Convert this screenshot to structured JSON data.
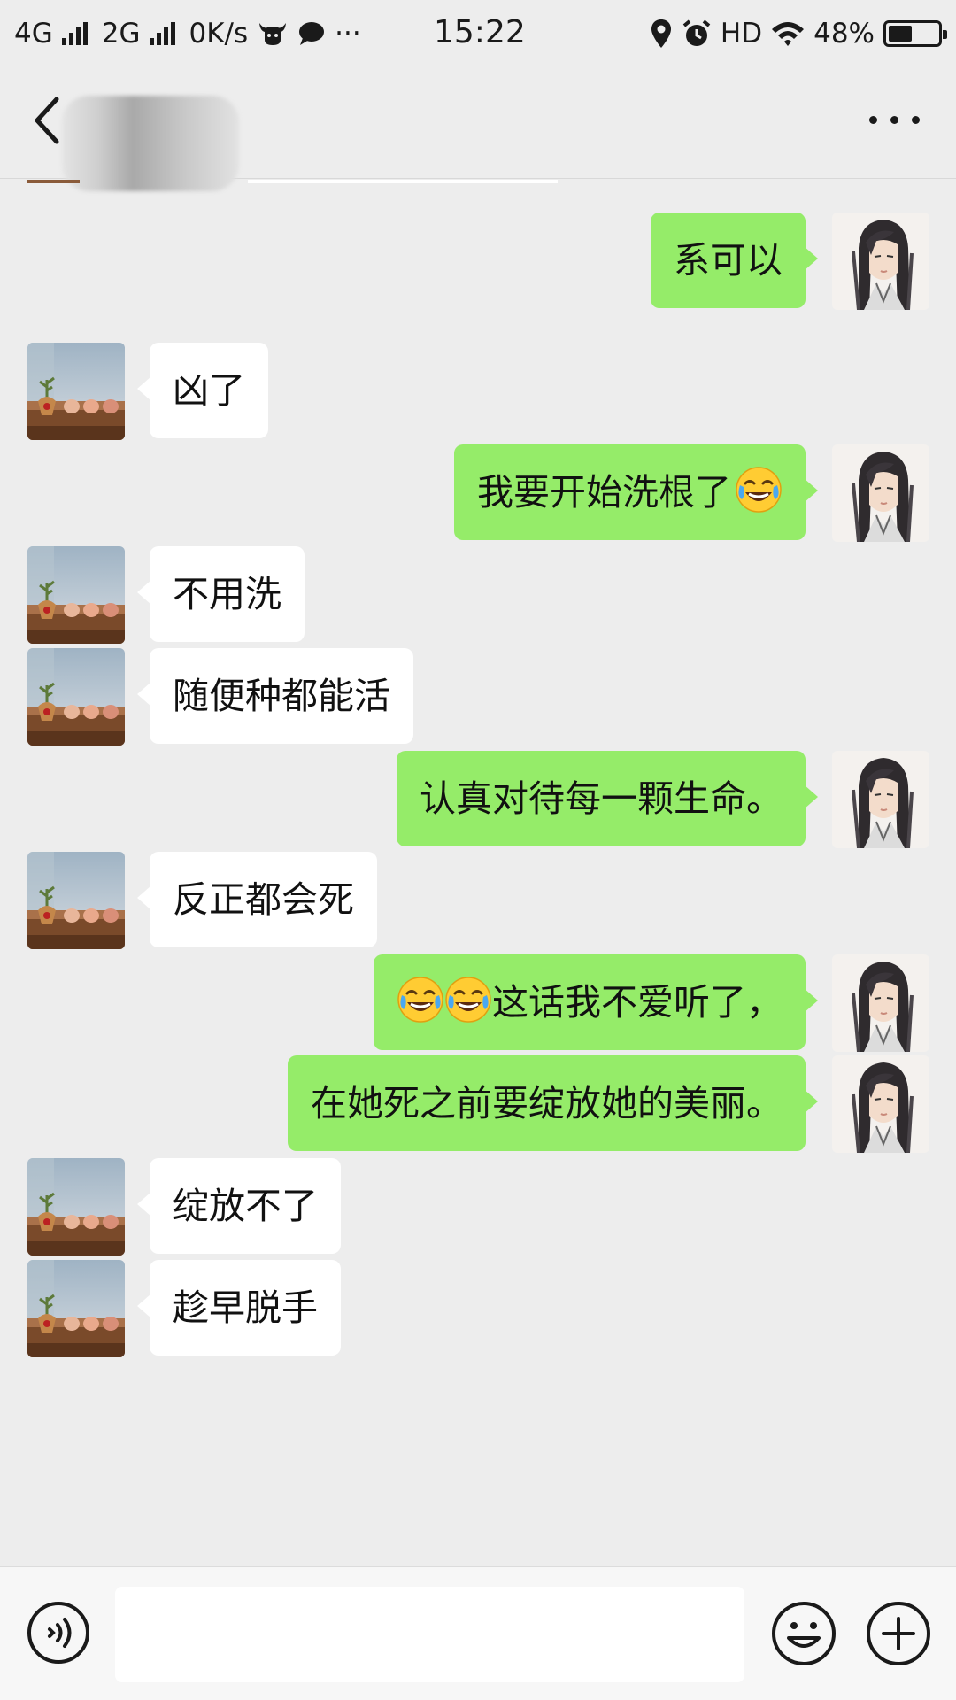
{
  "status_bar": {
    "network_1": "4G",
    "network_2": "2G",
    "speed": "0K/s",
    "more": "···",
    "time": "15:22",
    "hd": "HD",
    "battery": "48%",
    "battery_level": 0.48
  },
  "header": {
    "title": "",
    "title_obscured": true
  },
  "messages": [
    {
      "side": "right",
      "text": "系可以"
    },
    {
      "side": "left",
      "text": "凶了"
    },
    {
      "side": "right",
      "text": "我要开始洗根了",
      "emoji_after": [
        "crying-laughing"
      ]
    },
    {
      "side": "left",
      "text": " 不用洗"
    },
    {
      "side": "left",
      "text": "随便种都能活"
    },
    {
      "side": "right",
      "text": "认真对待每一颗生命。"
    },
    {
      "side": "left",
      "text": "反正都会死"
    },
    {
      "side": "right",
      "text": "这话我不爱听了，",
      "emoji_before": [
        "crying-laughing",
        "crying-laughing"
      ]
    },
    {
      "side": "right",
      "text": "在她死之前要绽放她的美丽。"
    },
    {
      "side": "left",
      "text": "绽放不了"
    },
    {
      "side": "left",
      "text": "趁早脱手"
    }
  ],
  "input_bar": {
    "value": "",
    "placeholder": ""
  },
  "colors": {
    "background": "#ededed",
    "sent_bubble": "#95ec69",
    "received_bubble": "#ffffff"
  }
}
